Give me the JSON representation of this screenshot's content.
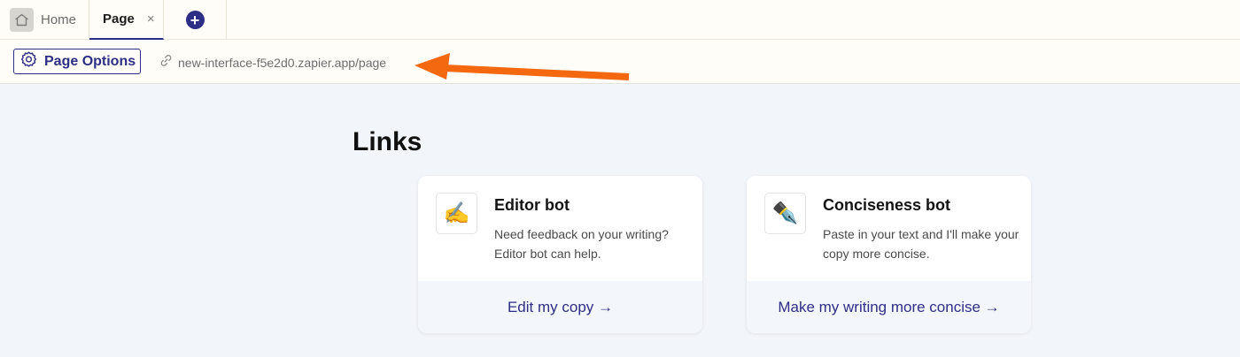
{
  "tabs": {
    "home_label": "Home",
    "page_label": "Page",
    "close_glyph": "×",
    "add_glyph": "+"
  },
  "toolbar": {
    "page_options_label": "Page Options",
    "url": "new-interface-f5e2d0.zapier.app/page"
  },
  "main": {
    "title": "Links",
    "cards": [
      {
        "emoji": "✍️",
        "title": "Editor bot",
        "description": "Need feedback on your writing? Editor bot can help.",
        "link": "Edit my copy →"
      },
      {
        "emoji": "✒️",
        "title": "Conciseness bot",
        "description": "Paste in your text and I'll make your copy more concise.",
        "link": "Make my writing more concise →"
      }
    ]
  },
  "colors": {
    "accent": "#2d2e86",
    "annotation_arrow": "#f4680f",
    "page_background": "#f2f5fa",
    "header_background": "#fffdf7"
  },
  "icons": {
    "home": "home-icon",
    "add": "plus-circle-icon",
    "settings": "gear-icon",
    "link": "link-icon"
  }
}
